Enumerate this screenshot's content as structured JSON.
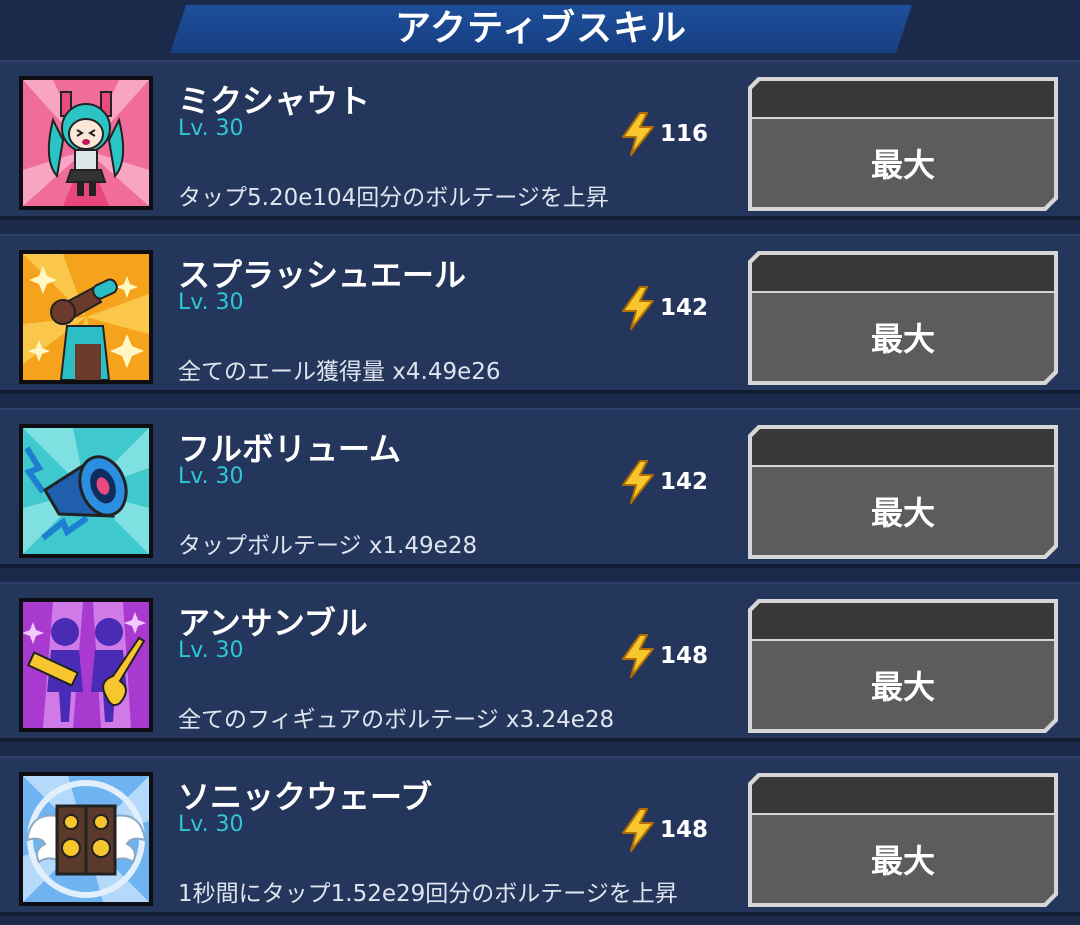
{
  "header": {
    "title": "アクティブスキル"
  },
  "colors": {
    "background": "#1b2a4a",
    "row": "#24365b",
    "level": "#2fc7d6",
    "banner": "#1d4f9b",
    "button": "#5c5c5c"
  },
  "skills": [
    {
      "name": "ミクシャウト",
      "level": "Lv. 30",
      "cost": "116",
      "description": "タップ5.20e104回分のボルテージを上昇",
      "button": "最大",
      "icon": "miku-shout-icon"
    },
    {
      "name": "スプラッシュエール",
      "level": "Lv. 30",
      "cost": "142",
      "description": "全てのエール獲得量 x4.49e26",
      "button": "最大",
      "icon": "splash-yell-icon"
    },
    {
      "name": "フルボリューム",
      "level": "Lv. 30",
      "cost": "142",
      "description": "タップボルテージ x1.49e28",
      "button": "最大",
      "icon": "megaphone-icon"
    },
    {
      "name": "アンサンブル",
      "level": "Lv. 30",
      "cost": "148",
      "description": "全てのフィギュアのボルテージ x3.24e28",
      "button": "最大",
      "icon": "ensemble-icon"
    },
    {
      "name": "ソニックウェーブ",
      "level": "Lv. 30",
      "cost": "148",
      "description": "1秒間にタップ1.52e29回分のボルテージを上昇",
      "button": "最大",
      "icon": "speaker-icon"
    }
  ]
}
